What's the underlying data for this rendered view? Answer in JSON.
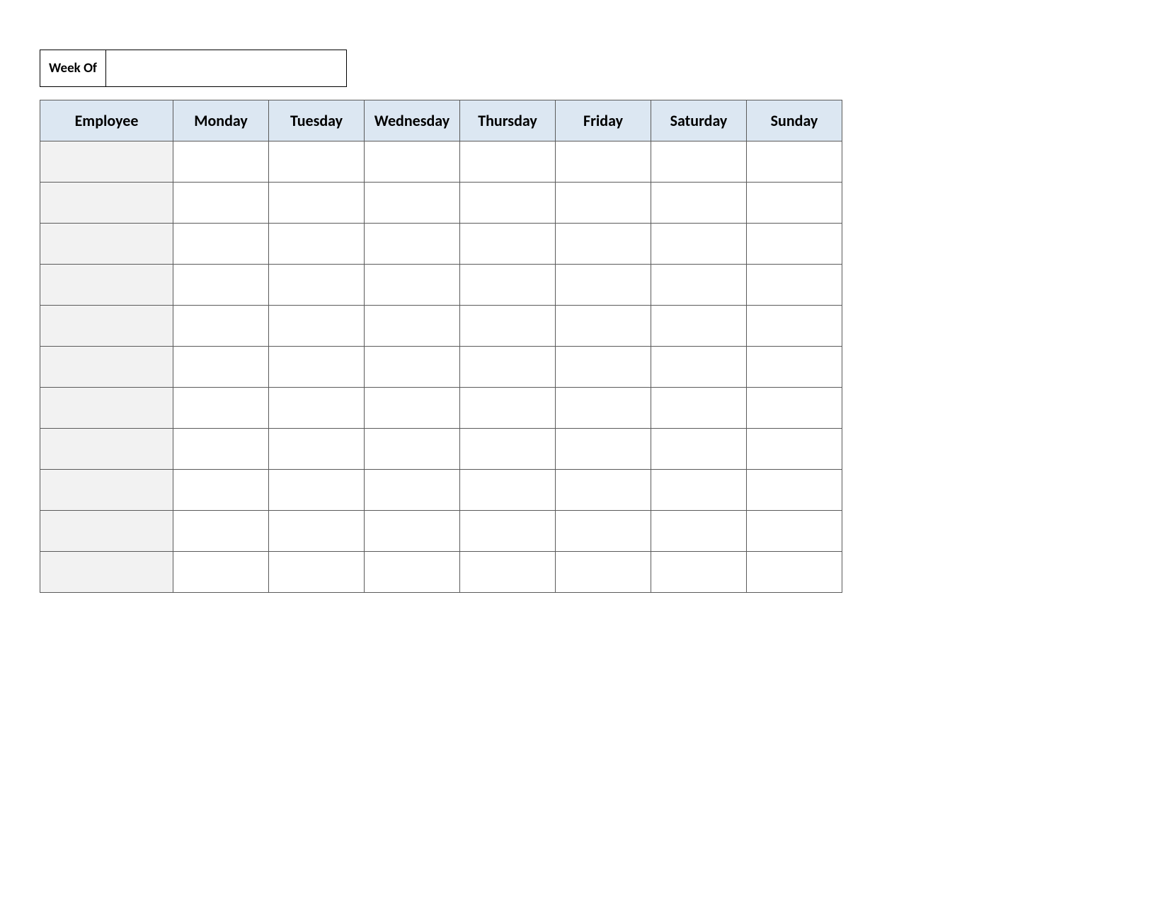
{
  "week_of": {
    "label": "Week Of",
    "value": ""
  },
  "headers": {
    "employee": "Employee",
    "days": [
      "Monday",
      "Tuesday",
      "Wednesday",
      "Thursday",
      "Friday",
      "Saturday",
      "Sunday"
    ]
  },
  "rows": [
    {
      "employee": "",
      "cells": [
        "",
        "",
        "",
        "",
        "",
        "",
        ""
      ]
    },
    {
      "employee": "",
      "cells": [
        "",
        "",
        "",
        "",
        "",
        "",
        ""
      ]
    },
    {
      "employee": "",
      "cells": [
        "",
        "",
        "",
        "",
        "",
        "",
        ""
      ]
    },
    {
      "employee": "",
      "cells": [
        "",
        "",
        "",
        "",
        "",
        "",
        ""
      ]
    },
    {
      "employee": "",
      "cells": [
        "",
        "",
        "",
        "",
        "",
        "",
        ""
      ]
    },
    {
      "employee": "",
      "cells": [
        "",
        "",
        "",
        "",
        "",
        "",
        ""
      ]
    },
    {
      "employee": "",
      "cells": [
        "",
        "",
        "",
        "",
        "",
        "",
        ""
      ]
    },
    {
      "employee": "",
      "cells": [
        "",
        "",
        "",
        "",
        "",
        "",
        ""
      ]
    },
    {
      "employee": "",
      "cells": [
        "",
        "",
        "",
        "",
        "",
        "",
        ""
      ]
    },
    {
      "employee": "",
      "cells": [
        "",
        "",
        "",
        "",
        "",
        "",
        ""
      ]
    },
    {
      "employee": "",
      "cells": [
        "",
        "",
        "",
        "",
        "",
        "",
        ""
      ]
    }
  ]
}
